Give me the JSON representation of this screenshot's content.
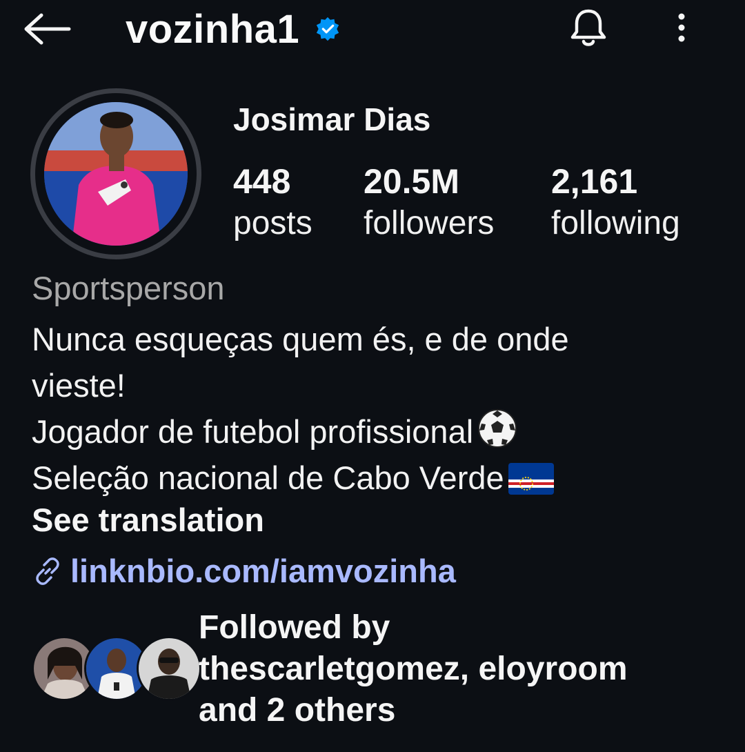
{
  "header": {
    "username": "vozinha1",
    "verified": true,
    "icons": {
      "back": "back-arrow-icon",
      "verified": "verified-badge-icon",
      "notifications": "bell-icon",
      "more": "more-vertical-icon"
    }
  },
  "profile": {
    "full_name": "Josimar Dias",
    "stats": [
      {
        "value": "448",
        "label": "posts"
      },
      {
        "value": "20.5M",
        "label": "followers"
      },
      {
        "value": "2,161",
        "label": "following"
      }
    ],
    "category": "Sportsperson",
    "bio_lines": [
      "Nunca esqueças quem és, e de onde",
      "vieste!",
      "Jogador de futebol profissional",
      "Seleção nacional de Cabo Verde"
    ],
    "see_translation": "See translation",
    "link": "linknbio.com/iamvozinha"
  },
  "followed_by": {
    "line1": "Followed by",
    "line2": "thescarletgomez, eloyroom",
    "line3": "and 2 others"
  },
  "colors": {
    "background": "#0c0f14",
    "link": "#a9b9ff",
    "verified": "#0095f6",
    "muted": "#a8a8a8"
  }
}
